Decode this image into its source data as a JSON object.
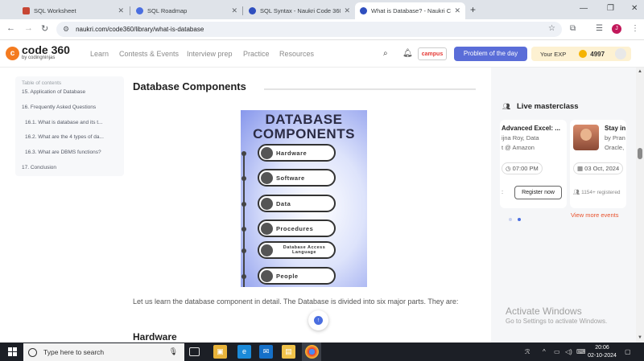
{
  "browser": {
    "tabs": [
      {
        "title": "SQL Worksheet",
        "favicon_color": "#c74634"
      },
      {
        "title": "SQL Roadmap",
        "favicon_color": "#4a6ee0"
      },
      {
        "title": "SQL Syntax - Naukri Code 360",
        "favicon_color": "#2f4fbf"
      },
      {
        "title": "What is Database? - Naukri Co...",
        "favicon_color": "#2f4fbf"
      }
    ],
    "new_tab_symbol": "+",
    "url": "naukri.com/code360/library/what-is-database",
    "profile_initial": "J"
  },
  "site": {
    "logo_mark": "c",
    "logo_text": "code 360",
    "logo_sub": "by codingninjas",
    "nav": [
      "Learn",
      "Contests & Events",
      "Interview prep",
      "Practice",
      "Resources"
    ],
    "campus_label": "campus",
    "problem_button": "Problem of the day",
    "exp_label": "Your EXP",
    "exp_value": "4997"
  },
  "toc": {
    "title": "Table of contents",
    "items": [
      "15.   Application of Database",
      "16.   Frequently Asked Questions",
      "16.1.   What is database and its t...",
      "16.2.   What are the 4 types of da...",
      "16.3.   What are DBMS functions?",
      "17.   Conclusion"
    ]
  },
  "article": {
    "heading": "Database Components",
    "image": {
      "title_line1": "DATABASE",
      "title_line2": "COMPONENTS",
      "components": [
        "Hardware",
        "Software",
        "Data",
        "Procedures",
        "Database Access Language",
        "People"
      ]
    },
    "paragraph": "Let us learn the database component in detail. The Database is divided into six major parts. They are:",
    "subheading": "Hardware"
  },
  "masterclass": {
    "title": "Live masterclass",
    "card1": {
      "title": "Advanced Excel: ...",
      "line1": "ijna Roy, Data",
      "line2": "t @ Amazon",
      "time": "07:00 PM",
      "button": "Register now"
    },
    "card2": {
      "title": "Stay in",
      "line1": "by Pran",
      "line2": "Oracle,",
      "date": "03 Oct, 2024",
      "registered": "1154+ registered"
    },
    "view_more": "View more events"
  },
  "windows": {
    "activate_title": "Activate Windows",
    "activate_sub": "Go to Settings to activate Windows.",
    "search_placeholder": "Type here to search",
    "time": "20:06",
    "date": "02-10-2024"
  }
}
